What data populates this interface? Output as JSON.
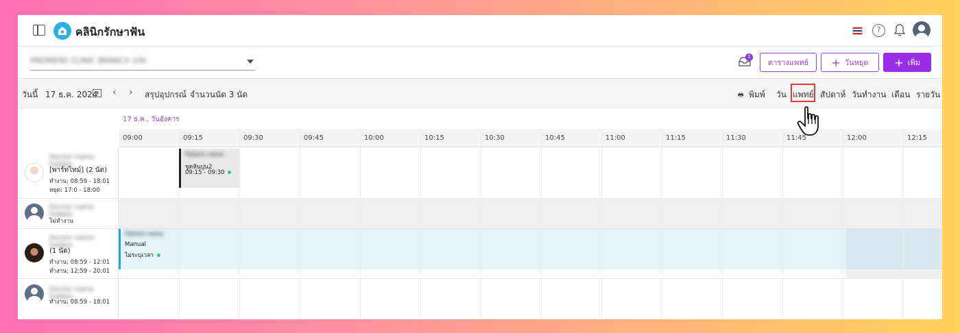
{
  "header": {
    "app_title": "คลินิกรักษาฟัน",
    "icons": [
      "sidebar-toggle-icon",
      "clinic-logo-icon",
      "thai-flag-icon",
      "help-icon",
      "bell-icon",
      "user-avatar"
    ]
  },
  "toolbar": {
    "branch_value": "PREMIERE CLINIC BRANCH 100",
    "inbox_badge": "2",
    "doctor_schedule_label": "ตารางแพทย์",
    "holiday_label": "วันหยุด",
    "add_label": "เพิ่ม",
    "accent_color": "#9b2de6"
  },
  "calendar_bar": {
    "today_label": "วันนี้",
    "date": "17 ธ.ค. 2024",
    "prev": "‹",
    "next": "›",
    "equipment_label": "สรุปอุปกรณ์",
    "appointment_count": "จำนวนนัด 3 นัด",
    "print_label": "พิมพ์",
    "views": [
      "วัน",
      "แพทย์",
      "สัปดาห์",
      "วันทำงาน",
      "เดือน",
      "รายวัน"
    ],
    "active_view": "แพทย์"
  },
  "schedule": {
    "date_label": "17 ธ.ค., วันอังคาร",
    "times": [
      "09:00",
      "09:15",
      "09:30",
      "09:45",
      "10:00",
      "10:15",
      "10:30",
      "10:45",
      "11:00",
      "11:15",
      "11:30",
      "11:45",
      "12:00",
      "12:15"
    ],
    "doctors": [
      {
        "name": "Doctor name hidden",
        "line1": "[พาร์ทไทม์] (2 นัด)",
        "line2": "ทำงาน: 08:59 - 18:01",
        "line3": "หยุด: 17:0 - 18:00"
      },
      {
        "name": "Doctor name hidden",
        "line1": "ไม่ทำงาน"
      },
      {
        "name": "Doctor name hidden",
        "line1": "(1 นัด)",
        "line2": "ทำงาน: 08:59 - 12:01",
        "line3": "ทำงาน: 12:59 - 20:01"
      },
      {
        "name": "Doctor name hidden",
        "line1": "ทำงาน: 08:59 - 18:01"
      }
    ],
    "appointments": [
      {
        "patient": "Patient name",
        "treatment": "ขูดหินปูน2",
        "time": "09:15 - 09:30"
      },
      {
        "patient": "Patient name",
        "treatment": "Manual",
        "time": "ไม่ระบุเวลา"
      }
    ]
  }
}
